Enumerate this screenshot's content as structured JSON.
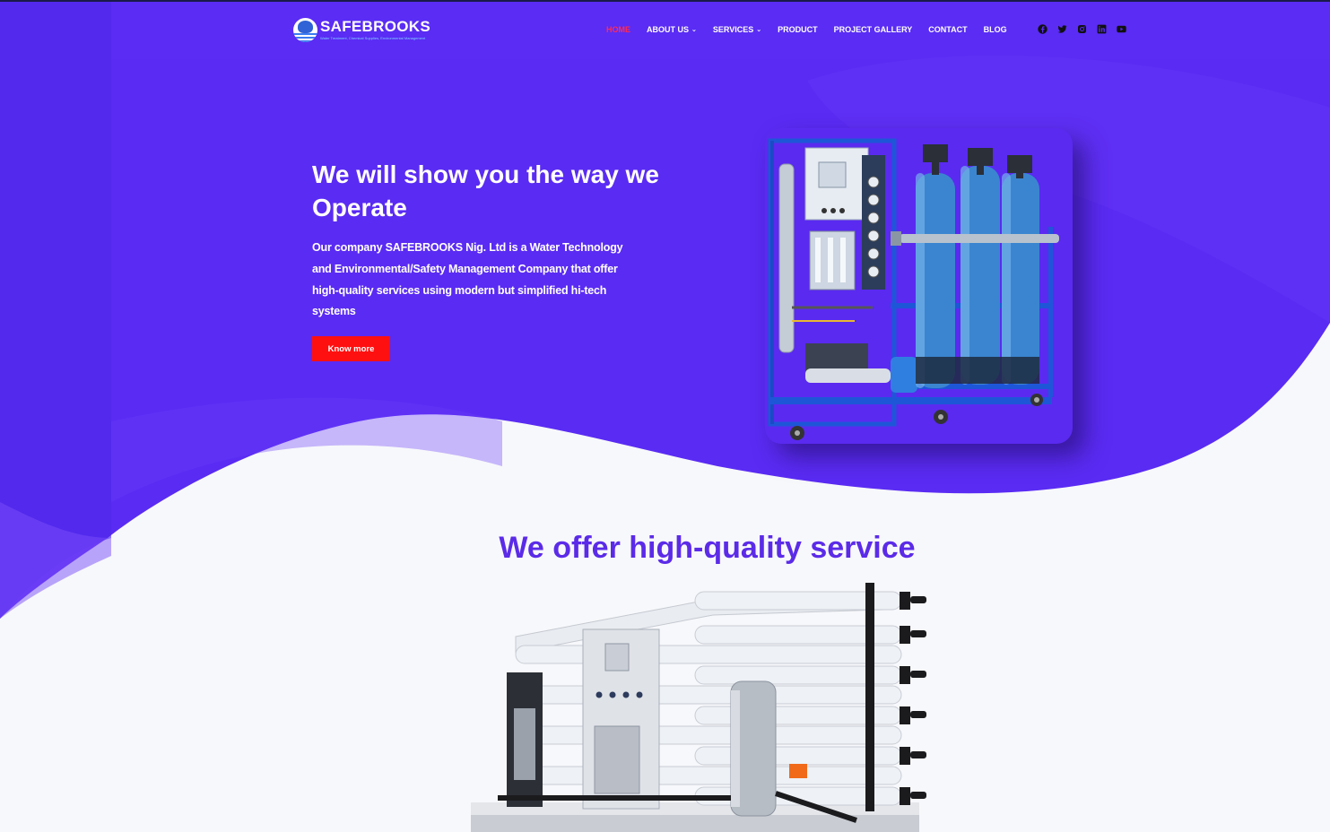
{
  "brand": {
    "name": "SAFEBROOKS",
    "tagline": "Water Treatment, Chemical Supplies, Environmental Management"
  },
  "nav": {
    "items": [
      {
        "label": "HOME",
        "active": true,
        "dropdown": false
      },
      {
        "label": "ABOUT US",
        "active": false,
        "dropdown": true
      },
      {
        "label": "SERVICES",
        "active": false,
        "dropdown": true
      },
      {
        "label": "PRODUCT",
        "active": false,
        "dropdown": false
      },
      {
        "label": "PROJECT GALLERY",
        "active": false,
        "dropdown": false
      },
      {
        "label": "CONTACT",
        "active": false,
        "dropdown": false
      },
      {
        "label": "BLOG",
        "active": false,
        "dropdown": false
      }
    ],
    "caret": "⌄"
  },
  "socials": [
    "facebook-icon",
    "twitter-icon",
    "instagram-icon",
    "linkedin-icon",
    "youtube-icon"
  ],
  "hero": {
    "title": "We will show you the way we Operate",
    "description": "Our company SAFEBROOKS Nig. Ltd is a Water Technology and Environmental/Safety Management Company that offer high-quality services using modern but simplified hi-tech systems",
    "button": "Know more"
  },
  "section": {
    "title": "We offer high-quality service"
  },
  "colors": {
    "primary": "#5b2bf5",
    "accent": "#ff1010",
    "active_nav": "#ff2a55",
    "section_title": "#5b2be8",
    "background": "#f7f8fb"
  }
}
